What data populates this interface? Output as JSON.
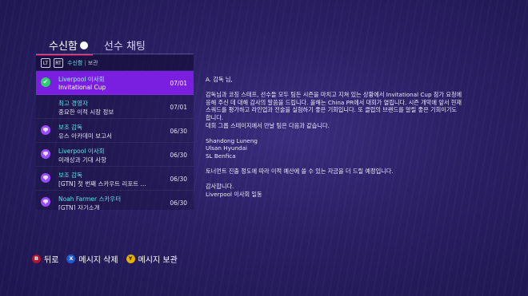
{
  "tabs": {
    "active": "수신함",
    "other": "선수 채팅"
  },
  "filter": {
    "lt": "LT",
    "rt": "RT",
    "active": "수신함",
    "separator": "|",
    "other": "보관"
  },
  "messages": [
    {
      "sender": "Liverpool 이사회",
      "subject": "Invitational Cup",
      "date": "07/01",
      "icon": "check-icon"
    },
    {
      "sender": "최고 경영자",
      "subject": "중요한 이적 시장 정보",
      "date": "07/01",
      "icon": "none"
    },
    {
      "sender": "보조 감독",
      "subject": "유스 아카데미 보고서",
      "date": "06/30",
      "icon": "chat-icon"
    },
    {
      "sender": "Liverpool 이사회",
      "subject": "미래상과 기대 사항",
      "date": "06/30",
      "icon": "chat-icon"
    },
    {
      "sender": "보조 감독",
      "subject": "[GTN] 첫 번째 스카우트 리포트 ...",
      "date": "06/30",
      "icon": "chat-icon"
    },
    {
      "sender": "Noah Farmer 스카우터",
      "subject": "[GTN] 자기소개",
      "date": "06/30",
      "icon": "chat-icon"
    }
  ],
  "message_body": {
    "greeting": "A. 감독 님,",
    "paragraph1": "감독님과 코칭 스태프, 선수들 모두 팀든 시즌을 마치고 지쳐 있는 상황에서 Invitational Cup 참가 요청에\n응해 주신 데 대해 감사의 말씀을 드립니다. 올해는 China PR에서 대회가 열립니다. 시즌 개막에 앞서 현재\n스쿼드를 평가하고 라인업과 전술을 실험하기 좋은 기회입니다. 또 클럽의 브랜드를 알릴 좋은 기회이기도\n합니다.\n대회 그룹 스테이지에서 만날 팀은 다음과 같습니다.",
    "teams": "Shandong Luneng\nUlsan Hyundai\nSL Benfica",
    "paragraph2": "토너먼트 진출 정도에 따라 이적 예산에 쓸 수 있는 자금을 더 드릴 예정입니다.",
    "closing": "감사합니다.\nLiverpool 이사회 일동"
  },
  "controls": [
    {
      "button": "B",
      "label": "뒤로"
    },
    {
      "button": "X",
      "label": "메시지 삭제"
    },
    {
      "button": "Y",
      "label": "메시지 보관"
    }
  ],
  "colors": {
    "accent_cyan": "#5fe3e6",
    "selected_row": "#7a1fe0",
    "tab_underline": "#ff3b8d"
  }
}
